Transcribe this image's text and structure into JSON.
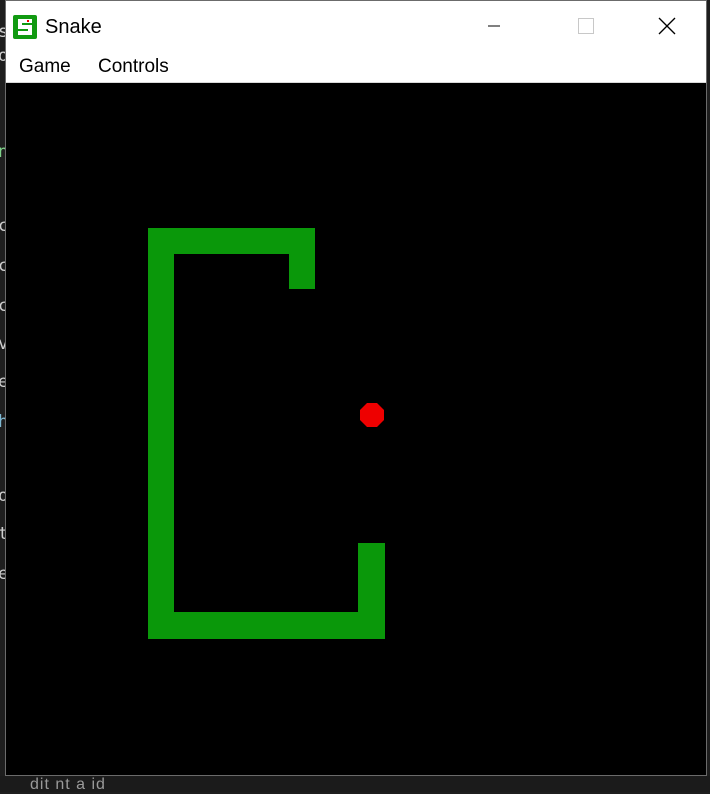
{
  "window": {
    "title": "Snake",
    "icon": "snake-app-icon",
    "controls": {
      "minimize_icon": "minimize-icon",
      "maximize_icon": "maximize-icon",
      "close_icon": "close-icon"
    }
  },
  "menu": {
    "items": [
      {
        "label": "Game"
      },
      {
        "label": "Controls"
      }
    ]
  },
  "game": {
    "background_color": "#000000",
    "snake_color": "#0a980a",
    "food_color": "#ee0000",
    "icon_color": "#119a11"
  },
  "background": {
    "editor_color": "#1e1e1e",
    "glyphs": [
      "son",
      "s",
      "o",
      "n",
      "c",
      "c",
      "c",
      "v",
      "e",
      "h",
      "o",
      "t",
      "e"
    ],
    "status_text": "dit        nt  a  id"
  }
}
